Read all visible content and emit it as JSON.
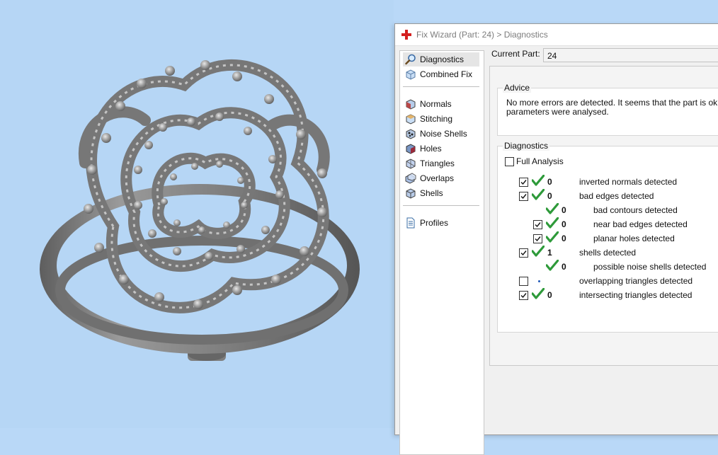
{
  "dialog": {
    "title": "Fix Wizard (Part: 24) > Diagnostics"
  },
  "nav": {
    "items": [
      {
        "label": "Diagnostics",
        "icon": "magnifier-icon",
        "active": true
      },
      {
        "label": "Combined Fix",
        "icon": "cube-icon"
      },
      {
        "label": "Normals",
        "icon": "normals-cube-icon"
      },
      {
        "label": "Stitching",
        "icon": "stitching-cube-icon"
      },
      {
        "label": "Noise Shells",
        "icon": "noise-shells-icon"
      },
      {
        "label": "Holes",
        "icon": "holes-cube-icon"
      },
      {
        "label": "Triangles",
        "icon": "triangles-icon"
      },
      {
        "label": "Overlaps",
        "icon": "overlaps-icon"
      },
      {
        "label": "Shells",
        "icon": "shells-icon"
      },
      {
        "label": "Profiles",
        "icon": "document-icon"
      }
    ]
  },
  "current_part": {
    "label": "Current Part:",
    "value": "24"
  },
  "advice": {
    "title": "Advice",
    "line1": "No more errors are detected. It seems that the part is ok. N",
    "line2": "parameters were analysed."
  },
  "diagnostics": {
    "title": "Diagnostics",
    "full_analysis": "Full Analysis",
    "rows": [
      {
        "count": "0",
        "label": "inverted normals detected",
        "checked": true,
        "status": "ok"
      },
      {
        "count": "0",
        "label": "bad edges detected",
        "checked": true,
        "status": "ok"
      },
      {
        "count": "0",
        "label": "bad contours detected",
        "status": "ok"
      },
      {
        "count": "0",
        "label": "near bad edges detected",
        "checked": true,
        "status": "ok"
      },
      {
        "count": "0",
        "label": "planar holes detected",
        "checked": true,
        "status": "ok"
      },
      {
        "count": "1",
        "label": "shells detected",
        "checked": true,
        "status": "ok"
      },
      {
        "count": "0",
        "label": "possible noise shells detected",
        "status": "ok"
      },
      {
        "count": "",
        "label": "overlapping triangles detected",
        "checked": false,
        "status": "not-analysed"
      },
      {
        "count": "0",
        "label": "intersecting triangles detected",
        "checked": true,
        "status": "ok"
      }
    ]
  },
  "colors": {
    "viewport_bg": "#b6d6f5",
    "model_gray": "#8c8c8c",
    "check_green": "#2e9a3a",
    "app_red": "#d42020"
  }
}
